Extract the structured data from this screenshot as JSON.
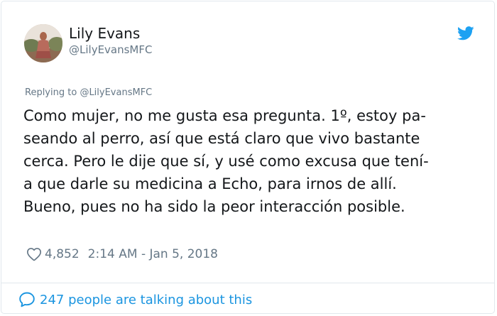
{
  "author": {
    "display_name": "Lily Evans",
    "handle": "@LilyEvansMFC"
  },
  "reply": {
    "prefix": "Replying to",
    "mention": "@LilyEvansMFC"
  },
  "tweet": {
    "lines": [
      "Como mujer, no me gusta esa pregunta. 1º, estoy pa-",
      "seando al perro, así que está claro que vivo bastante",
      "cerca. Pero le dije que sí, y usé como excusa que tení-",
      "a que darle su medicina a Echo, para irnos de allí.",
      "Bueno, pues no ha sido la peor interacción posible."
    ]
  },
  "meta": {
    "likes": "4,852",
    "timestamp": "2:14 AM - Jan 5, 2018"
  },
  "footer": {
    "talking": "247 people are talking about this"
  },
  "colors": {
    "text": "#14171a",
    "secondary": "#657786",
    "link": "#1b95e0",
    "twitter_blue": "#1da1f2",
    "border": "#e1e8ed"
  },
  "icons": {
    "brand": "twitter-bird-icon",
    "like": "heart-icon",
    "conversation": "speech-bubble-icon"
  }
}
